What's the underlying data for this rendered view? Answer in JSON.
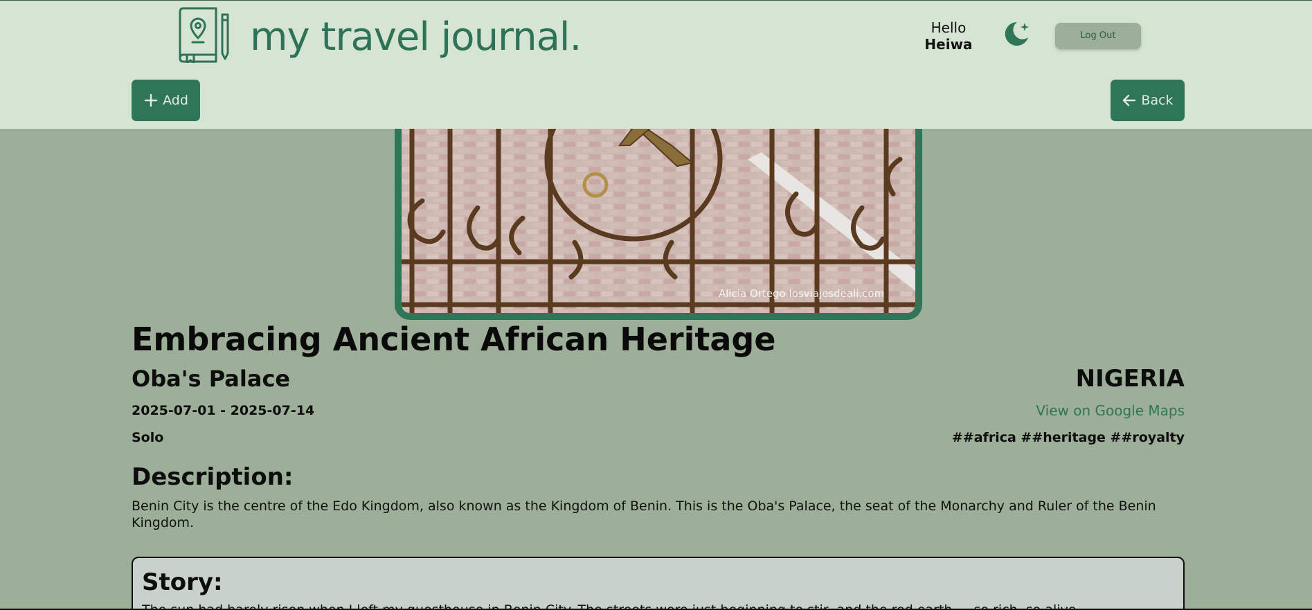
{
  "header": {
    "logo_text": "my travel journal.",
    "greeting": "Hello",
    "username": "Heiwa",
    "logout_label": "Log Out",
    "theme_icon": "moon-icon",
    "logo_icon": "journal-map-pin-icon"
  },
  "toolbar": {
    "add_label": "Add",
    "back_label": "Back"
  },
  "photo": {
    "credit": "Alicia Ortego losviajesdeali.com"
  },
  "entry": {
    "title": "Embracing Ancient African Heritage",
    "place": "Oba's Palace",
    "country": "NIGERIA",
    "dates": "2025-07-01 - 2025-07-14",
    "maps_link": "View on Google Maps",
    "company": "Solo",
    "tags": "##africa ##heritage ##royalty",
    "description_heading": "Description:",
    "description": "Benin City is the centre of the Edo Kingdom, also known as the Kingdom of Benin. This is the Oba's Palace, the seat of the Monarchy and Ruler of the Benin Kingdom.",
    "story_heading": "Story:",
    "story": "The sun had barely risen when I left my guesthouse in Benin City. The streets were just beginning to stir, and the red earth — so rich, so alive"
  },
  "colors": {
    "header_bg": "#d6e4d4",
    "page_bg": "#9daf98",
    "accent": "#2f7558",
    "story_bg": "#c9d2ca"
  }
}
